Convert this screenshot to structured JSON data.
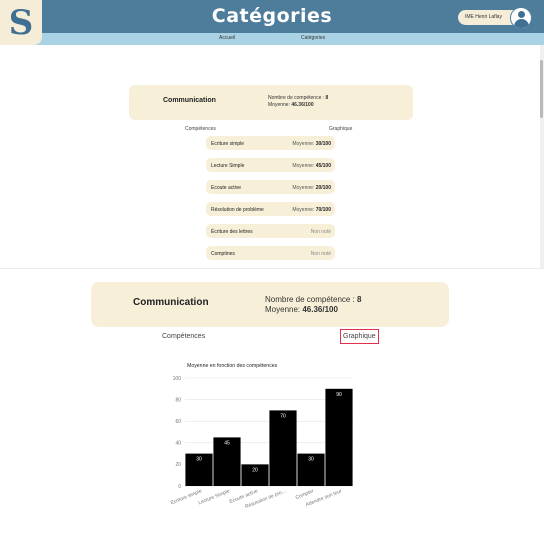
{
  "header": {
    "logo": "S",
    "title": "Catégories",
    "user": "IME Henri Laflay"
  },
  "nav": {
    "home": "Accueil",
    "categories": "Catégories"
  },
  "category": {
    "name": "Communication",
    "count_label": "Nombre de compétence : ",
    "count": "8",
    "avg_label": "Moyenne: ",
    "avg": "46.36/100"
  },
  "tabs": {
    "competences": "Compétences",
    "graph": "Graphique"
  },
  "avg_prefix": "Moyenne: ",
  "skills": [
    {
      "name": "Ecriture simple",
      "value": "30/100",
      "noted": true
    },
    {
      "name": "Lecture Simple",
      "value": "45/100",
      "noted": true
    },
    {
      "name": "Ecoute active",
      "value": "20/100",
      "noted": true
    },
    {
      "name": "Résolution de problème",
      "value": "70/100",
      "noted": true
    },
    {
      "name": "Écriture des lettres",
      "value": "Non noté",
      "noted": false
    },
    {
      "name": "Comptines",
      "value": "Non noté",
      "noted": false
    }
  ],
  "chart_data": {
    "type": "bar",
    "title": "Moyenne en fonction des compétences",
    "categories": [
      "Ecriture simple",
      "Lecture Simple",
      "Ecoute active",
      "Résolution de pro...",
      "Compter",
      "Attendre son tour"
    ],
    "values": [
      30,
      45,
      20,
      70,
      30,
      90
    ],
    "ylim": [
      0,
      100
    ],
    "yticks": [
      0,
      20,
      40,
      60,
      80,
      100
    ],
    "bar_color": "#000000",
    "grid": true
  }
}
